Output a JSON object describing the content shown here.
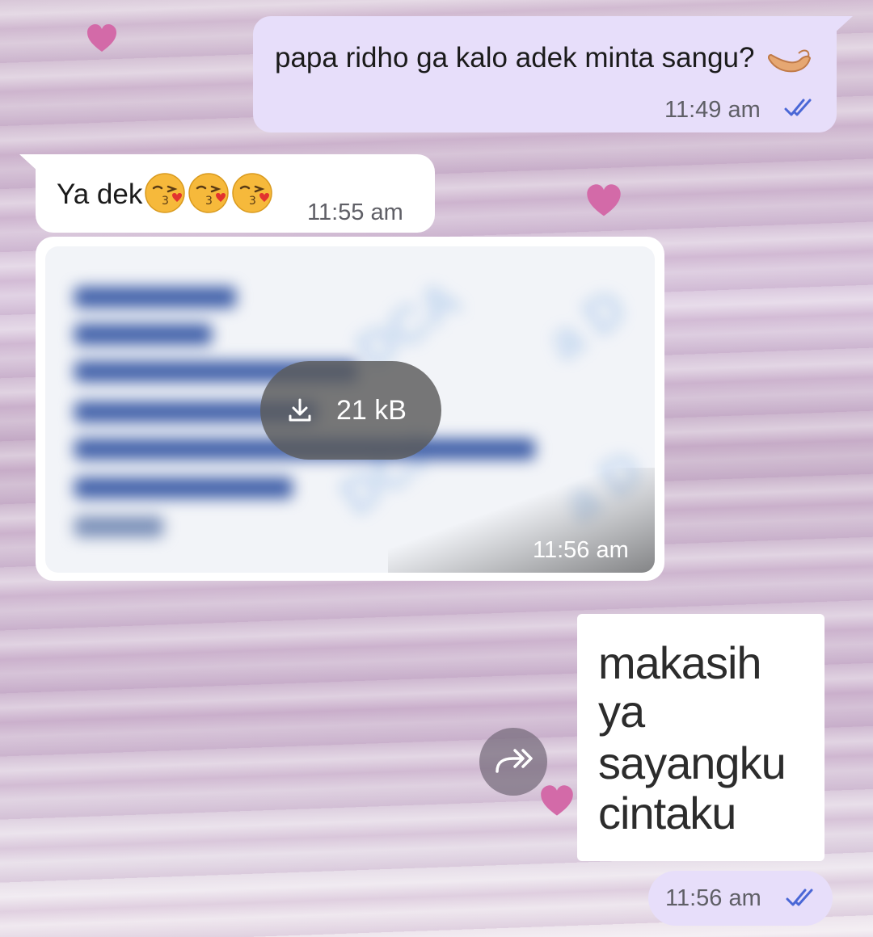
{
  "colors": {
    "outgoing_bubble": "#e7defa",
    "incoming_bubble": "#ffffff",
    "read_ticks": "#4a67d6",
    "heart": "#d36aa8"
  },
  "messages": [
    {
      "direction": "outgoing",
      "text": "papa ridho ga kalo adek minta sangu?",
      "emoji": "palm-up-hand",
      "time": "11:49 am",
      "status": "read-double-tick"
    },
    {
      "direction": "incoming",
      "text": "Ya dek",
      "emoji": [
        "kissing-face",
        "kissing-face",
        "kissing-face"
      ],
      "time": "11:55 am"
    },
    {
      "direction": "incoming",
      "type": "image",
      "download_size": "21 kB",
      "time": "11:56 am"
    },
    {
      "direction": "outgoing",
      "type": "sticker",
      "sticker_lines": [
        "makasih",
        "ya",
        "sayangku",
        "cintaku"
      ],
      "time": "11:56 am",
      "status": "read-double-tick"
    }
  ],
  "icons": {
    "download": "download-icon",
    "forward": "forward-icon",
    "heart": "heart-icon"
  }
}
